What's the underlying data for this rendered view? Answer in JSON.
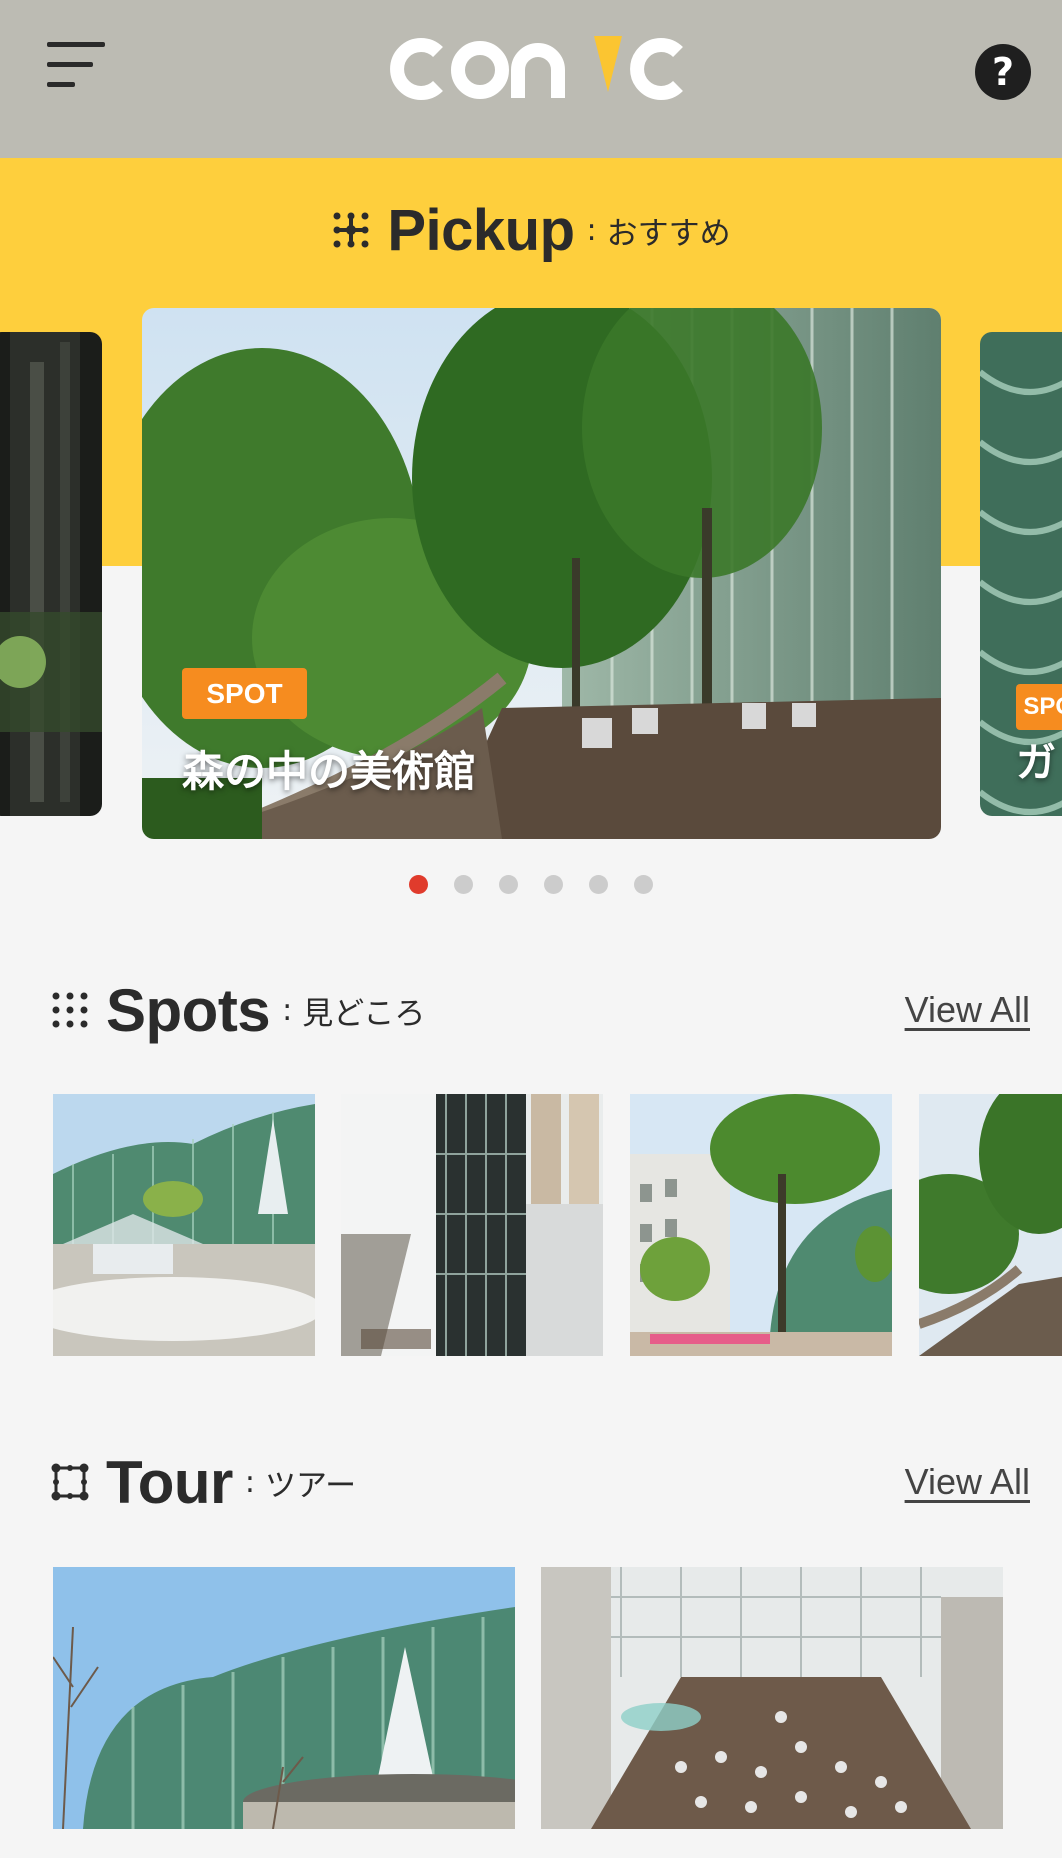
{
  "header": {
    "menu_icon": "hamburger-menu-icon",
    "logo_text": "conic",
    "help_icon": "question-circle-icon",
    "help_glyph": "?"
  },
  "pickup": {
    "title": "Pickup",
    "colon": ":",
    "subtitle": "おすすめ",
    "slides": [
      {
        "badge": "SPOT",
        "title": "森の中の美術館"
      },
      {
        "badge": "SPOT",
        "title": "ガ"
      }
    ],
    "pagination": {
      "count": 6,
      "active_index": 0
    }
  },
  "spots": {
    "title": "Spots",
    "colon": ":",
    "subtitle": "見どころ",
    "view_all": "View All"
  },
  "tour": {
    "title": "Tour",
    "colon": ":",
    "subtitle": "ツアー",
    "view_all": "View All"
  },
  "colors": {
    "header_bg": "#bcbbb3",
    "accent_yellow": "#fecf3d",
    "badge_orange": "#f68c1f",
    "active_dot": "#e03b2c",
    "page_bg": "#f5f5f5"
  }
}
